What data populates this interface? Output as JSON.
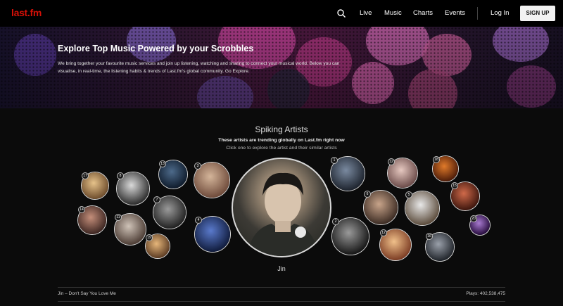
{
  "nav": {
    "logo": "last.fm",
    "links": [
      "Live",
      "Music",
      "Charts",
      "Events"
    ],
    "login": "Log In",
    "signup": "SIGN UP"
  },
  "hero": {
    "title": "Explore Top Music Powered by your Scrobbles",
    "description": "We bring together your favourite music services and join up listening, watching and sharing to connect your musical world. Below you can visualise, in real-time, the listening habits & trends of Last.fm's global community. Go Explore."
  },
  "spiking": {
    "title": "Spiking Artists",
    "subtitle": "These artists are trending globally on Last.fm right now",
    "hint": "Click one to explore the artist and their similar artists",
    "featured_artist": "Jin",
    "bubbles": [
      {
        "rank": "17",
        "colors": [
          "#e6c28a",
          "#6b4a2a"
        ]
      },
      {
        "rank": "8",
        "colors": [
          "#d9d9d9",
          "#2a2a2a"
        ]
      },
      {
        "rank": "13",
        "colors": [
          "#4d6a8a",
          "#0e1a2a"
        ]
      },
      {
        "rank": "3",
        "colors": [
          "#d4b59a",
          "#6e4a3a"
        ]
      },
      {
        "rank": "14",
        "colors": [
          "#c48e7a",
          "#3a2420"
        ]
      },
      {
        "rank": "11",
        "colors": [
          "#cfc3b8",
          "#4a3a32"
        ]
      },
      {
        "rank": "7",
        "colors": [
          "#9a9a9a",
          "#1f1f1f"
        ]
      },
      {
        "rank": "4",
        "colors": [
          "#5a7acc",
          "#0f1a3a"
        ]
      },
      {
        "rank": "19",
        "colors": [
          "#e6b67a",
          "#5a3a22"
        ]
      },
      {
        "rank": "1",
        "colors": [
          "#7a8aa0",
          "#1c222c"
        ]
      },
      {
        "rank": "12",
        "colors": [
          "#e6c8c0",
          "#6a4a48"
        ]
      },
      {
        "rank": "18",
        "colors": [
          "#e07a2a",
          "#4a1a08"
        ]
      },
      {
        "rank": "6",
        "colors": [
          "#c8a48a",
          "#3a2a22"
        ]
      },
      {
        "rank": "5",
        "colors": [
          "#e8e8e8",
          "#5a4a3a"
        ]
      },
      {
        "rank": "15",
        "colors": [
          "#d06a4a",
          "#3a140c"
        ]
      },
      {
        "rank": "2",
        "colors": [
          "#9a9a9a",
          "#141414"
        ]
      },
      {
        "rank": "12",
        "colors": [
          "#f0c08a",
          "#7a3a22"
        ]
      },
      {
        "rank": "16",
        "colors": [
          "#9aa0aa",
          "#1e2228"
        ]
      },
      {
        "rank": "20",
        "colors": [
          "#a87ad0",
          "#240a3a"
        ]
      }
    ]
  },
  "now_playing": {
    "track": "Jin – Don't Say You Love Me",
    "plays": "Plays: 402,538,475"
  },
  "colors": {
    "brand_red": "#d51007",
    "background": "#0b0b0b"
  }
}
